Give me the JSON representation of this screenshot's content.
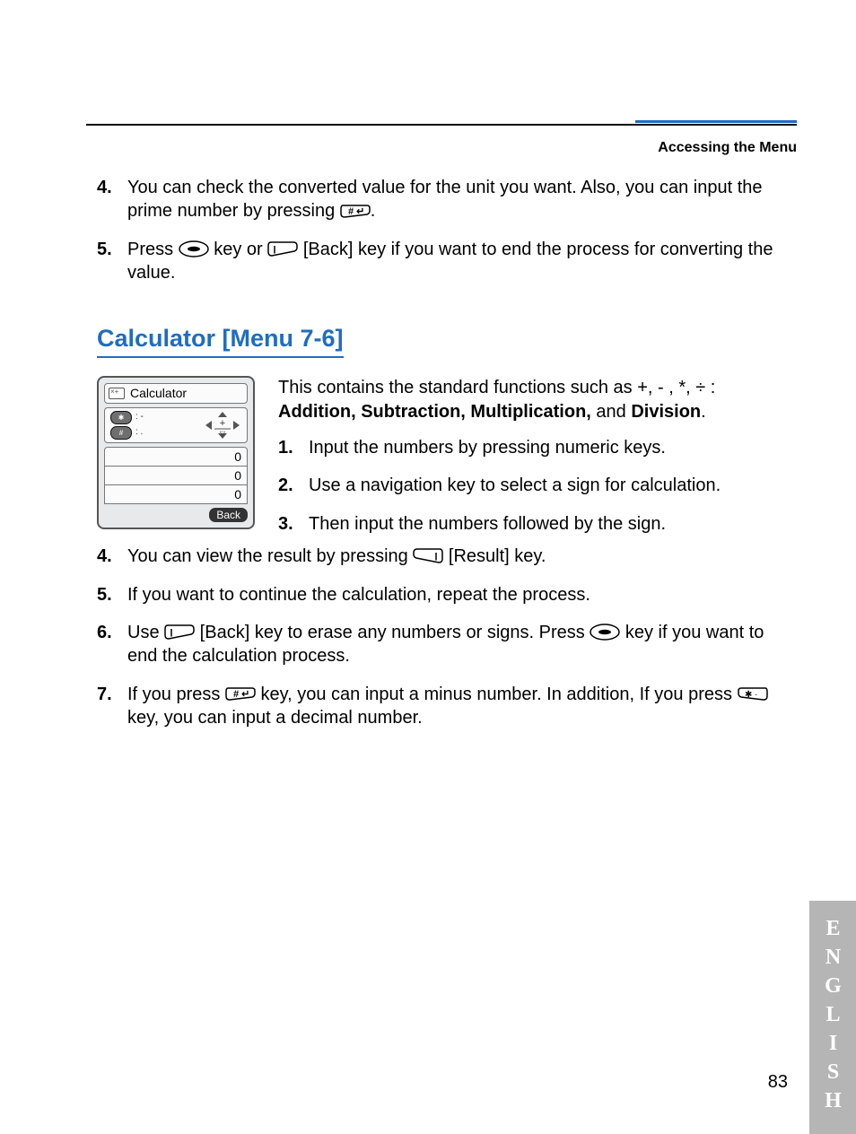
{
  "header": {
    "section": "Accessing the Menu"
  },
  "intro_steps": [
    {
      "num": "4.",
      "a": "You can check the converted value for the unit you want. Also, you can input the prime number by pressing ",
      "icon": "hash",
      "b": "."
    },
    {
      "num": "5.",
      "a": "Press ",
      "icon": "end",
      "b": " key or ",
      "icon2": "softright",
      "c": " [Back] key if you want to end the process for converting the value."
    }
  ],
  "section": {
    "title": "Calculator [Menu 7-6]"
  },
  "calc_fig": {
    "title": "Calculator",
    "star": "✱",
    "hash": "#",
    "star_dots": ": -",
    "hash_dots": ": .",
    "vals": [
      "0",
      "0",
      "0"
    ],
    "back": "Back"
  },
  "desc": {
    "lead": "This contains the standard functions such as +, - , *, ÷ : ",
    "bold1": "Addition, Subtraction, Multiplication,",
    "mid": " and ",
    "bold2": "Division",
    "tail": "."
  },
  "right_steps": [
    {
      "num": "1.",
      "text": "Input the numbers by pressing numeric keys."
    },
    {
      "num": "2.",
      "text": "Use a navigation key to select a sign for calculation."
    },
    {
      "num": "3.",
      "text": "Then input the numbers followed by the sign."
    }
  ],
  "bottom_steps": [
    {
      "num": "4.",
      "a": "You can view the result by pressing ",
      "icon": "softleft",
      "b": " [Result] key."
    },
    {
      "num": "5.",
      "a": "If you want to continue the calculation, repeat the process."
    },
    {
      "num": "6.",
      "a": "Use ",
      "icon": "softright",
      "b": " [Back] key to erase any numbers or signs. Press ",
      "icon2": "end",
      "c": " key if you want to end the calculation process."
    },
    {
      "num": "7.",
      "a": "If you press ",
      "icon": "hash",
      "b": " key, you can input a minus number. In addition, If you press ",
      "icon2": "star",
      "c": " key, you can input a decimal number."
    }
  ],
  "side_label": "ENGLISH",
  "page_number": "83"
}
